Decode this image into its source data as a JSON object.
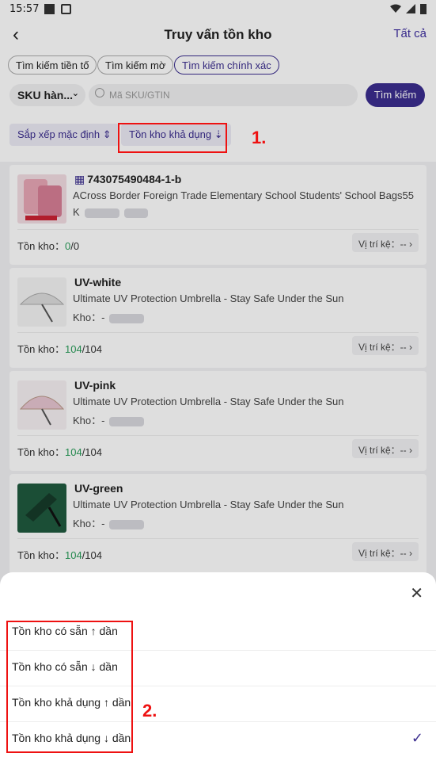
{
  "status": {
    "time": "15:57"
  },
  "header": {
    "title": "Truy vấn tồn kho",
    "right_link": "Tất cả"
  },
  "tabs": [
    "Tìm kiếm tiền tố",
    "Tìm kiếm mờ",
    "Tìm kiếm chính xác"
  ],
  "search": {
    "dropdown": "SKU hàn...",
    "placeholder": "Mã SKU/GTIN",
    "button": "Tìm kiếm"
  },
  "sort": {
    "default": "Sắp xếp mặc định",
    "available": "Tồn kho khả dụng"
  },
  "annotations": {
    "one": "1.",
    "two": "2."
  },
  "items": [
    {
      "sku": "743075490484-1-b",
      "desc": "ACross Border Foreign Trade Elementary School Students' School Bags55",
      "kho": "K",
      "stock_label": "Tồn kho：",
      "stock_avail": "0",
      "stock_total": "/0",
      "slot": "Vị trí kệ：--"
    },
    {
      "sku": "UV-white",
      "desc": "Ultimate UV Protection Umbrella - Stay Safe Under the Sun",
      "kho": "Kho：-",
      "stock_label": "Tồn kho：",
      "stock_avail": "104",
      "stock_total": "/104",
      "slot": "Vị trí kệ：--"
    },
    {
      "sku": "UV-pink",
      "desc": "Ultimate UV Protection Umbrella - Stay Safe Under the Sun",
      "kho": "Kho：-",
      "stock_label": "Tồn kho：",
      "stock_avail": "104",
      "stock_total": "/104",
      "slot": "Vị trí kệ：--"
    },
    {
      "sku": "UV-green",
      "desc": "Ultimate UV Protection Umbrella - Stay Safe Under the Sun",
      "kho": "Kho：-",
      "stock_label": "Tồn kho：",
      "stock_avail": "104",
      "stock_total": "/104",
      "slot": "Vị trí kệ：--"
    }
  ],
  "sheet": {
    "options": [
      "Tồn kho có sẵn ↑ dần",
      "Tồn kho có sẵn ↓ dần",
      "Tồn kho khả dụng ↑ dần",
      "Tồn kho khả dụng ↓ dần"
    ],
    "selected": "Tồn kho khả dụng ↓ dần"
  },
  "colors": {
    "accent": "#3b2d8f",
    "annotation": "#e11111",
    "stock_green": "#2a9d5a"
  }
}
